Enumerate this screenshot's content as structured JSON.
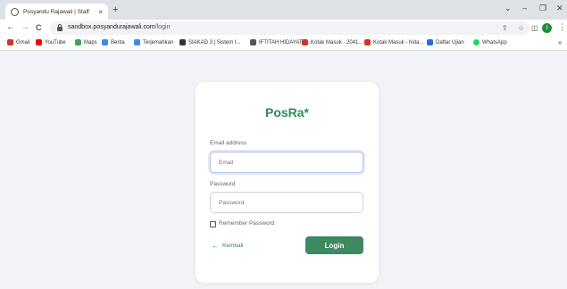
{
  "browser": {
    "tab_title": "Posyandu Rajawali | Staff",
    "tab_close": "×",
    "new_tab": "+",
    "window_controls": {
      "collapse": "⌄",
      "minimize": "–",
      "restore": "❐",
      "close": "✕"
    },
    "nav": {
      "back": "←",
      "forward": "→",
      "reload": "C"
    },
    "url_host": "sandbox.posyandurajawali.com",
    "url_path": "/login",
    "omni_icons": {
      "share": "⇪",
      "star": "☆",
      "sidebar": "◫"
    },
    "profile_initial": "I",
    "menu": "⋮"
  },
  "bookmarks": {
    "items": [
      {
        "label": "Gmail",
        "color": "#d93025"
      },
      {
        "label": "YouTube",
        "color": "#ff0000"
      },
      {
        "label": "Maps",
        "color": "#34a853"
      },
      {
        "label": "Berita",
        "color": "#4285f4"
      },
      {
        "label": "Terjemahkan",
        "color": "#4285f4"
      },
      {
        "label": "SIAKAD 3 | Sistem I...",
        "color": "#333333"
      },
      {
        "label": "IFTITAH HIDAYATI |...",
        "color": "#555555"
      },
      {
        "label": "Kotak Masuk - 2041...",
        "color": "#d93025"
      },
      {
        "label": "Kotak Masuk - hida...",
        "color": "#d93025"
      },
      {
        "label": "Daftar Ujian",
        "color": "#1a73e8"
      },
      {
        "label": "WhatsApp",
        "color": "#25d366"
      }
    ],
    "more": "»"
  },
  "login": {
    "brand": "PosRa*",
    "email_label": "Email address",
    "email_placeholder": "Email",
    "password_label": "Password",
    "password_placeholder": "Password",
    "remember_label": "Remember Password",
    "back_label": "Kembali",
    "back_arrow": "←",
    "submit_label": "Login"
  },
  "colors": {
    "accent": "#3d8a62",
    "brand": "#2e8b57",
    "page_bg": "#f1f3f7"
  }
}
